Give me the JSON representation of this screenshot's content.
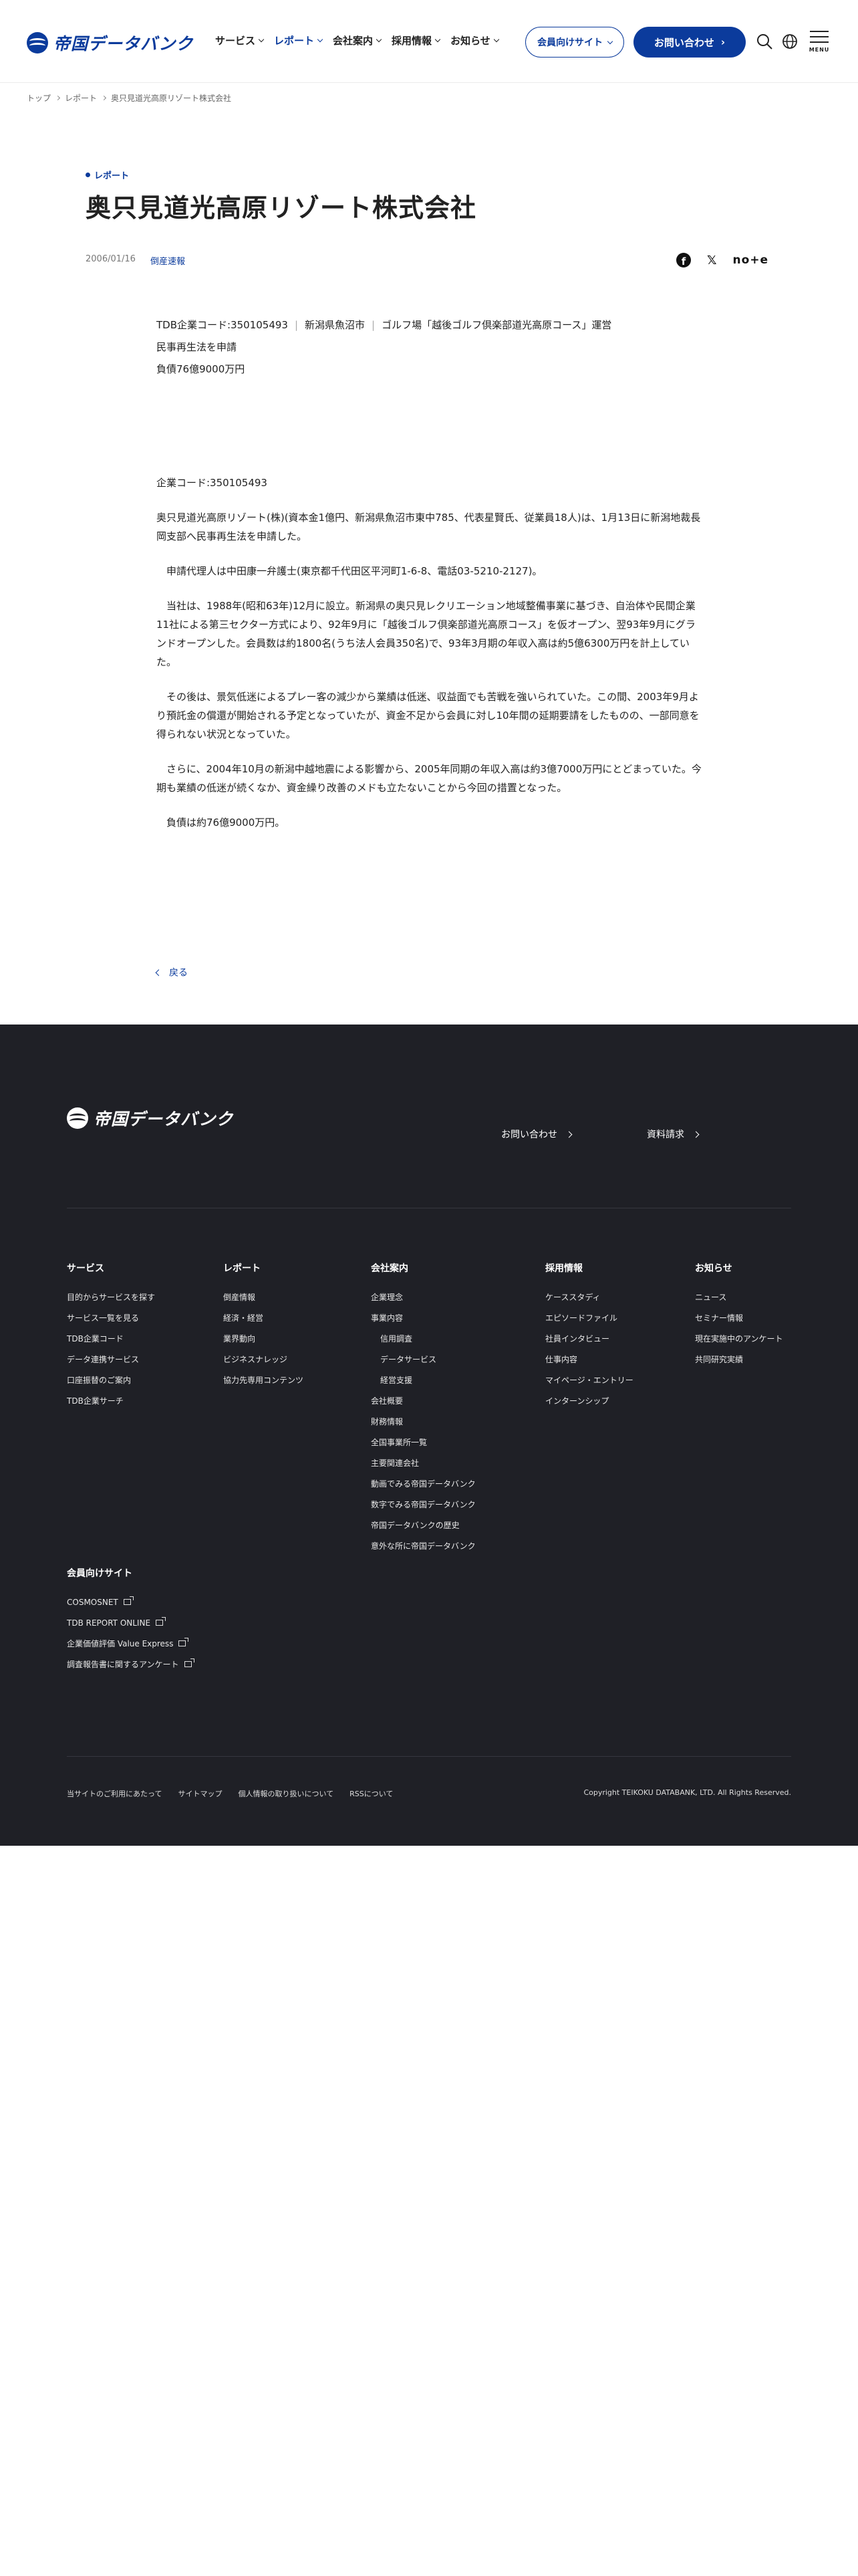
{
  "header": {
    "logo_text": "帝国データバンク",
    "nav": [
      {
        "label": "サービス",
        "active": false
      },
      {
        "label": "レポート",
        "active": true
      },
      {
        "label": "会社案内",
        "active": false
      },
      {
        "label": "採用情報",
        "active": false
      },
      {
        "label": "お知らせ",
        "active": false
      }
    ],
    "member_site": "会員向けサイト",
    "contact": "お問い合わせ",
    "contact_arrow": "›",
    "menu_label": "MENU",
    "accent": "#0b3b9c"
  },
  "breadcrumb": [
    "トップ",
    "レポート",
    "奥只見道光高原リゾート株式会社"
  ],
  "article": {
    "category": "レポート",
    "title": "奥只見道光高原リゾート株式会社",
    "date": "2006/01/16",
    "tag": "倒産速報",
    "share": {
      "facebook": "f",
      "x": "𝕏",
      "note": "no+e"
    },
    "summary": {
      "code": "TDB企業コード:350105493",
      "city": "新潟県魚沼市",
      "business": "ゴルフ場「越後ゴルフ倶楽部道光高原コース」運営",
      "procedure": "民事再生法を申請",
      "debt": "負債76億9000万円"
    },
    "paragraphs": [
      "企業コード:350105493",
      "奥只見道光高原リゾート(株)(資本金1億円、新潟県魚沼市東中785、代表星賢氏、従業員18人)は、1月13日に新潟地裁長岡支部へ民事再生法を申請した。",
      "　申請代理人は中田康一弁護士(東京都千代田区平河町1-6-8、電話03-5210-2127)。",
      "　当社は、1988年(昭和63年)12月に設立。新潟県の奥只見レクリエーション地域整備事業に基づき、自治体や民間企業11社による第三セクター方式により、92年9月に「越後ゴルフ倶楽部道光高原コース」を仮オープン、翌93年9月にグランドオープンした。会員数は約1800名(うち法人会員350名)で、93年3月期の年収入高は約5億6300万円を計上していた。",
      "　その後は、景気低迷によるプレー客の減少から業績は低迷、収益面でも苦戦を強いられていた。この間、2003年9月より預託金の償還が開始される予定となっていたが、資金不足から会員に対し10年間の延期要請をしたものの、一部同意を得られない状況となっていた。",
      "　さらに、2004年10月の新潟中越地震による影響から、2005年同期の年収入高は約3億7000万円にとどまっていた。今期も業績の低迷が続くなか、資金繰り改善のメドも立たないことから今回の措置となった。",
      "　負債は約76億9000万円。"
    ],
    "back": "戻る"
  },
  "footer": {
    "logo_text": "帝国データバンク",
    "cta_contact": "お問い合わせ",
    "cta_docs": "資料請求",
    "columns": [
      {
        "head": "サービス",
        "links": [
          "目的からサービスを探す",
          "サービス一覧を見る",
          "TDB企業コード",
          "データ連携サービス",
          "口座振替のご案内",
          "TDB企業サーチ"
        ]
      },
      {
        "head": "レポート",
        "links": [
          "倒産情報",
          "経済・経営",
          "業界動向",
          "ビジネスナレッジ",
          "協力先専用コンテンツ"
        ]
      },
      {
        "head": "会社案内",
        "links": [
          "企業理念",
          "事業内容",
          "信用調査",
          "データサービス",
          "経営支援",
          "会社概要",
          "財務情報",
          "全国事業所一覧",
          "主要関連会社",
          "動画でみる帝国データバンク",
          "数字でみる帝国データバンク",
          "帝国データバンクの歴史",
          "意外な所に帝国データバンク"
        ]
      },
      {
        "head": "採用情報",
        "links": [
          "ケーススタディ",
          "エピソードファイル",
          "社員インタビュー",
          "仕事内容",
          "マイページ・エントリー",
          "インターンシップ"
        ]
      },
      {
        "head": "お知らせ",
        "links": [
          "ニュース",
          "セミナー情報",
          "現在実施中のアンケート",
          "共同研究実績"
        ]
      }
    ],
    "member_head": "会員向けサイト",
    "member_links": [
      "COSMOSNET",
      "TDB REPORT ONLINE",
      "企業価値評価 Value Express",
      "調査報告書に関するアンケート"
    ],
    "bottom_links": [
      "当サイトのご利用にあたって",
      "サイトマップ",
      "個人情報の取り扱いについて",
      "RSSについて"
    ],
    "copyright": "Copyright TEIKOKU DATABANK, LTD. All Rights Reserved.",
    "background": "#1f2026"
  }
}
